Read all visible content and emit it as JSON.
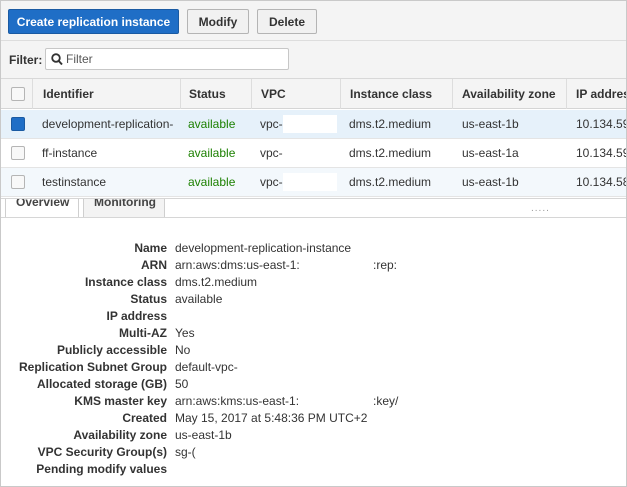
{
  "toolbar": {
    "create_label": "Create replication instance",
    "modify_label": "Modify",
    "delete_label": "Delete"
  },
  "filter": {
    "label": "Filter:",
    "placeholder": "Filter",
    "icon": "search-icon"
  },
  "table": {
    "columns": [
      "Identifier",
      "Status",
      "VPC",
      "Instance class",
      "Availability zone",
      "IP address"
    ],
    "rows": [
      {
        "identifier": "development-replication-i",
        "status": "available",
        "vpc": "vpc-",
        "instance_class": "dms.t2.medium",
        "az": "us-east-1b",
        "ip": "10.134.59",
        "selected": true
      },
      {
        "identifier": "ff-instance",
        "status": "available",
        "vpc": "vpc-",
        "instance_class": "dms.t2.medium",
        "az": "us-east-1a",
        "ip": "10.134.59",
        "selected": false
      },
      {
        "identifier": "testinstance",
        "status": "available",
        "vpc": "vpc-",
        "instance_class": "dms.t2.medium",
        "az": "us-east-1b",
        "ip": "10.134.58",
        "selected": false
      }
    ]
  },
  "tabs": {
    "overview": "Overview",
    "monitoring": "Monitoring",
    "resize_handle": "....."
  },
  "details": {
    "name": {
      "label": "Name",
      "value": "development-replication-instance"
    },
    "arn": {
      "label": "ARN",
      "value": "arn:aws:dms:us-east-1:",
      "suffix": ":rep:"
    },
    "instance_class": {
      "label": "Instance class",
      "value": "dms.t2.medium"
    },
    "status": {
      "label": "Status",
      "value": "available"
    },
    "ip_address": {
      "label": "IP address",
      "value": ""
    },
    "multi_az": {
      "label": "Multi-AZ",
      "value": "Yes"
    },
    "publicly_accessible": {
      "label": "Publicly accessible",
      "value": "No"
    },
    "subnet_group": {
      "label": "Replication Subnet Group",
      "value": "default-vpc-"
    },
    "allocated_storage": {
      "label": "Allocated storage (GB)",
      "value": "50"
    },
    "kms_key": {
      "label": "KMS master key",
      "value": "arn:aws:kms:us-east-1:",
      "suffix": ":key/"
    },
    "created": {
      "label": "Created",
      "value": "May 15, 2017 at 5:48:36 PM UTC+2"
    },
    "availability_zone": {
      "label": "Availability zone",
      "value": "us-east-1b"
    },
    "vpc_security_groups": {
      "label": "VPC Security Group(s)",
      "value": "sg-("
    },
    "pending_modify": {
      "label": "Pending modify values",
      "value": ""
    }
  },
  "colors": {
    "primary_button": "#1f6ec6",
    "status_available": "#1d8102",
    "selected_row": "#e6f1fa"
  }
}
